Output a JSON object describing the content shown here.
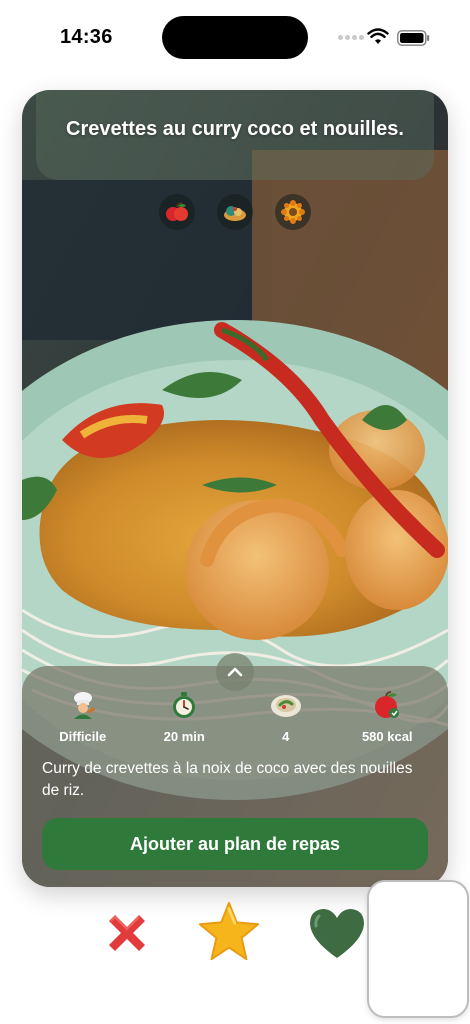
{
  "status_bar": {
    "time": "14:36"
  },
  "recipe": {
    "title": "Crevettes au curry coco et nouilles.",
    "tags": [
      "apple-icon",
      "lunch-bowl-icon",
      "spice-icon"
    ],
    "stats": [
      {
        "icon": "chef-icon",
        "label": "Difficile"
      },
      {
        "icon": "stopwatch-icon",
        "label": "20 min"
      },
      {
        "icon": "plate-icon",
        "label": "4"
      },
      {
        "icon": "apple-calories-icon",
        "label": "580 kcal"
      }
    ],
    "description": "Curry de crevettes à la noix de coco avec des nouilles de riz.",
    "add_button_label": "Ajouter au plan de repas"
  },
  "actions": {
    "dislike_icon": "cross-icon",
    "favorite_icon": "star-icon",
    "like_icon": "heart-icon"
  },
  "colors": {
    "accent_green": "#2f7a3b",
    "dislike_red": "#e23b3b",
    "star_yellow": "#f6b51a",
    "heart_green": "#3f6b43"
  }
}
